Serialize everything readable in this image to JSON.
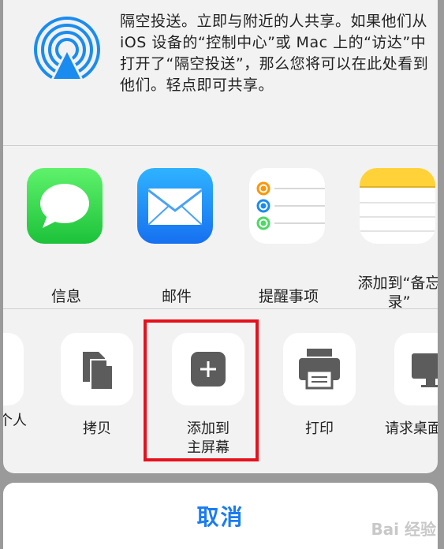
{
  "airdrop": {
    "icon": "airdrop-icon",
    "description": "隔空投送。立即与附近的人共享。如果他们从 iOS 设备的“控制中心”或 Mac 上的“访达”中打开了“隔空投送”，那么您将可以在此处看到他们。轻点即可共享。"
  },
  "apps": [
    {
      "label": "信息",
      "icon": "messages-icon"
    },
    {
      "label": "邮件",
      "icon": "mail-icon"
    },
    {
      "label": "提醒事项",
      "icon": "reminders-icon"
    },
    {
      "label": "添加到“备忘\n录”",
      "icon": "notes-icon"
    }
  ],
  "actions": [
    {
      "label": "个人",
      "icon": "partial-icon"
    },
    {
      "label": "拷贝",
      "icon": "copy-icon"
    },
    {
      "label": "添加到\n主屏幕",
      "icon": "add-square-icon"
    },
    {
      "label": "打印",
      "icon": "printer-icon"
    },
    {
      "label": "请求桌面",
      "icon": "desktop-icon"
    }
  ],
  "cancel_label": "取消",
  "watermark": "Bai 经验",
  "colors": {
    "highlight": "#e6111b",
    "accent": "#1a7cf4"
  }
}
